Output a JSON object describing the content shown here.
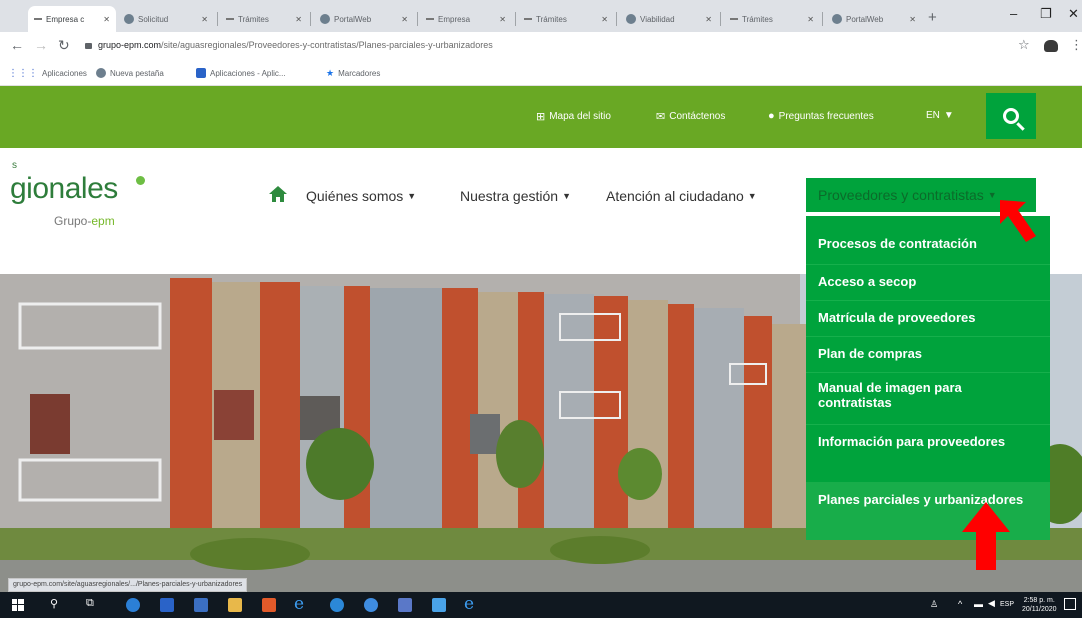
{
  "browser": {
    "tabs": [
      {
        "title": "Empresa c",
        "active": true
      },
      {
        "title": "Solicitud",
        "active": false
      },
      {
        "title": "Trámites",
        "active": false
      },
      {
        "title": "PortalWeb",
        "active": false
      },
      {
        "title": "Empresa",
        "active": false
      },
      {
        "title": "Trámites",
        "active": false
      },
      {
        "title": "Viabilidad",
        "active": false
      },
      {
        "title": "Trámites",
        "active": false
      },
      {
        "title": "PortalWeb",
        "active": false
      }
    ],
    "new_tab": "+",
    "url_host": "grupo-epm.com",
    "url_path": "/site/aguasregionales/Proveedores-y-contratistas/Planes-parciales-y-urbanizadores",
    "bookmarks": [
      "Aplicaciones",
      "Nueva pestaña",
      "Aplicaciones - Aplic...",
      "Marcadores"
    ],
    "status_url": "grupo-epm.com/site/aguasregionales/.../Planes-parciales-y-urbanizadores"
  },
  "site": {
    "toplinks": [
      "Mapa del sitio",
      "Contáctenos",
      "Preguntas frecuentes"
    ],
    "lang": "EN",
    "logo_s": "s",
    "logo_text": "gionales",
    "logo_sub_a": "Grupo-",
    "logo_sub_b": "epm",
    "menu": [
      "Quiénes somos",
      "Nuestra gestión",
      "Atención al ciudadano",
      "Proveedores y contratistas"
    ],
    "dropdown": [
      "Procesos de contratación",
      "Acceso a secop",
      "Matrícula de proveedores",
      "Plan de compras",
      "Manual de imagen para contratistas",
      "Información para proveedores",
      "Planes parciales y urbanizadores"
    ]
  },
  "taskbar": {
    "lang": "ESP",
    "time": "2:58 p. m.",
    "date": "20/11/2020"
  },
  "colors": {
    "topbar": "#69a824",
    "accent": "#00a33c",
    "arrow": "#ff0000"
  }
}
